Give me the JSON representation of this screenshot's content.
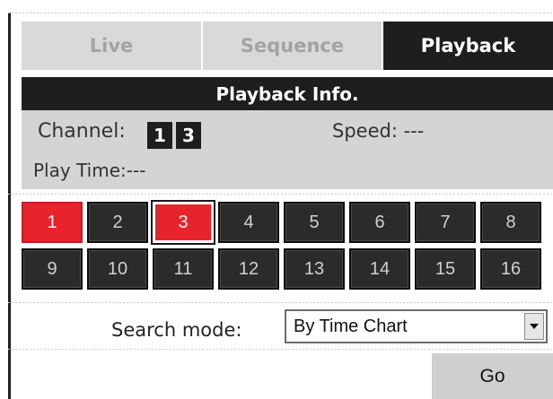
{
  "tabs": [
    {
      "label": "Live",
      "active": false
    },
    {
      "label": "Sequence",
      "active": false
    },
    {
      "label": "Playback",
      "active": true
    }
  ],
  "info": {
    "title": "Playback Info.",
    "channel_label": "Channel:",
    "channels": [
      "1",
      "3"
    ],
    "speed_label": "Speed:",
    "speed_value": "---",
    "playtime_label": "Play Time:",
    "playtime_value": "---"
  },
  "grid": {
    "channels": [
      "1",
      "2",
      "3",
      "4",
      "5",
      "6",
      "7",
      "8",
      "9",
      "10",
      "11",
      "12",
      "13",
      "14",
      "15",
      "16"
    ],
    "selected": [
      "1",
      "3"
    ],
    "focused": "3"
  },
  "search": {
    "label": "Search mode:",
    "selected": "By Time Chart"
  },
  "go_label": "Go",
  "colors": {
    "dark": "#1e1e1e",
    "selected": "#e8232c",
    "inactive_tab": "#d9d9d9",
    "panel": "#d4d4d4"
  }
}
